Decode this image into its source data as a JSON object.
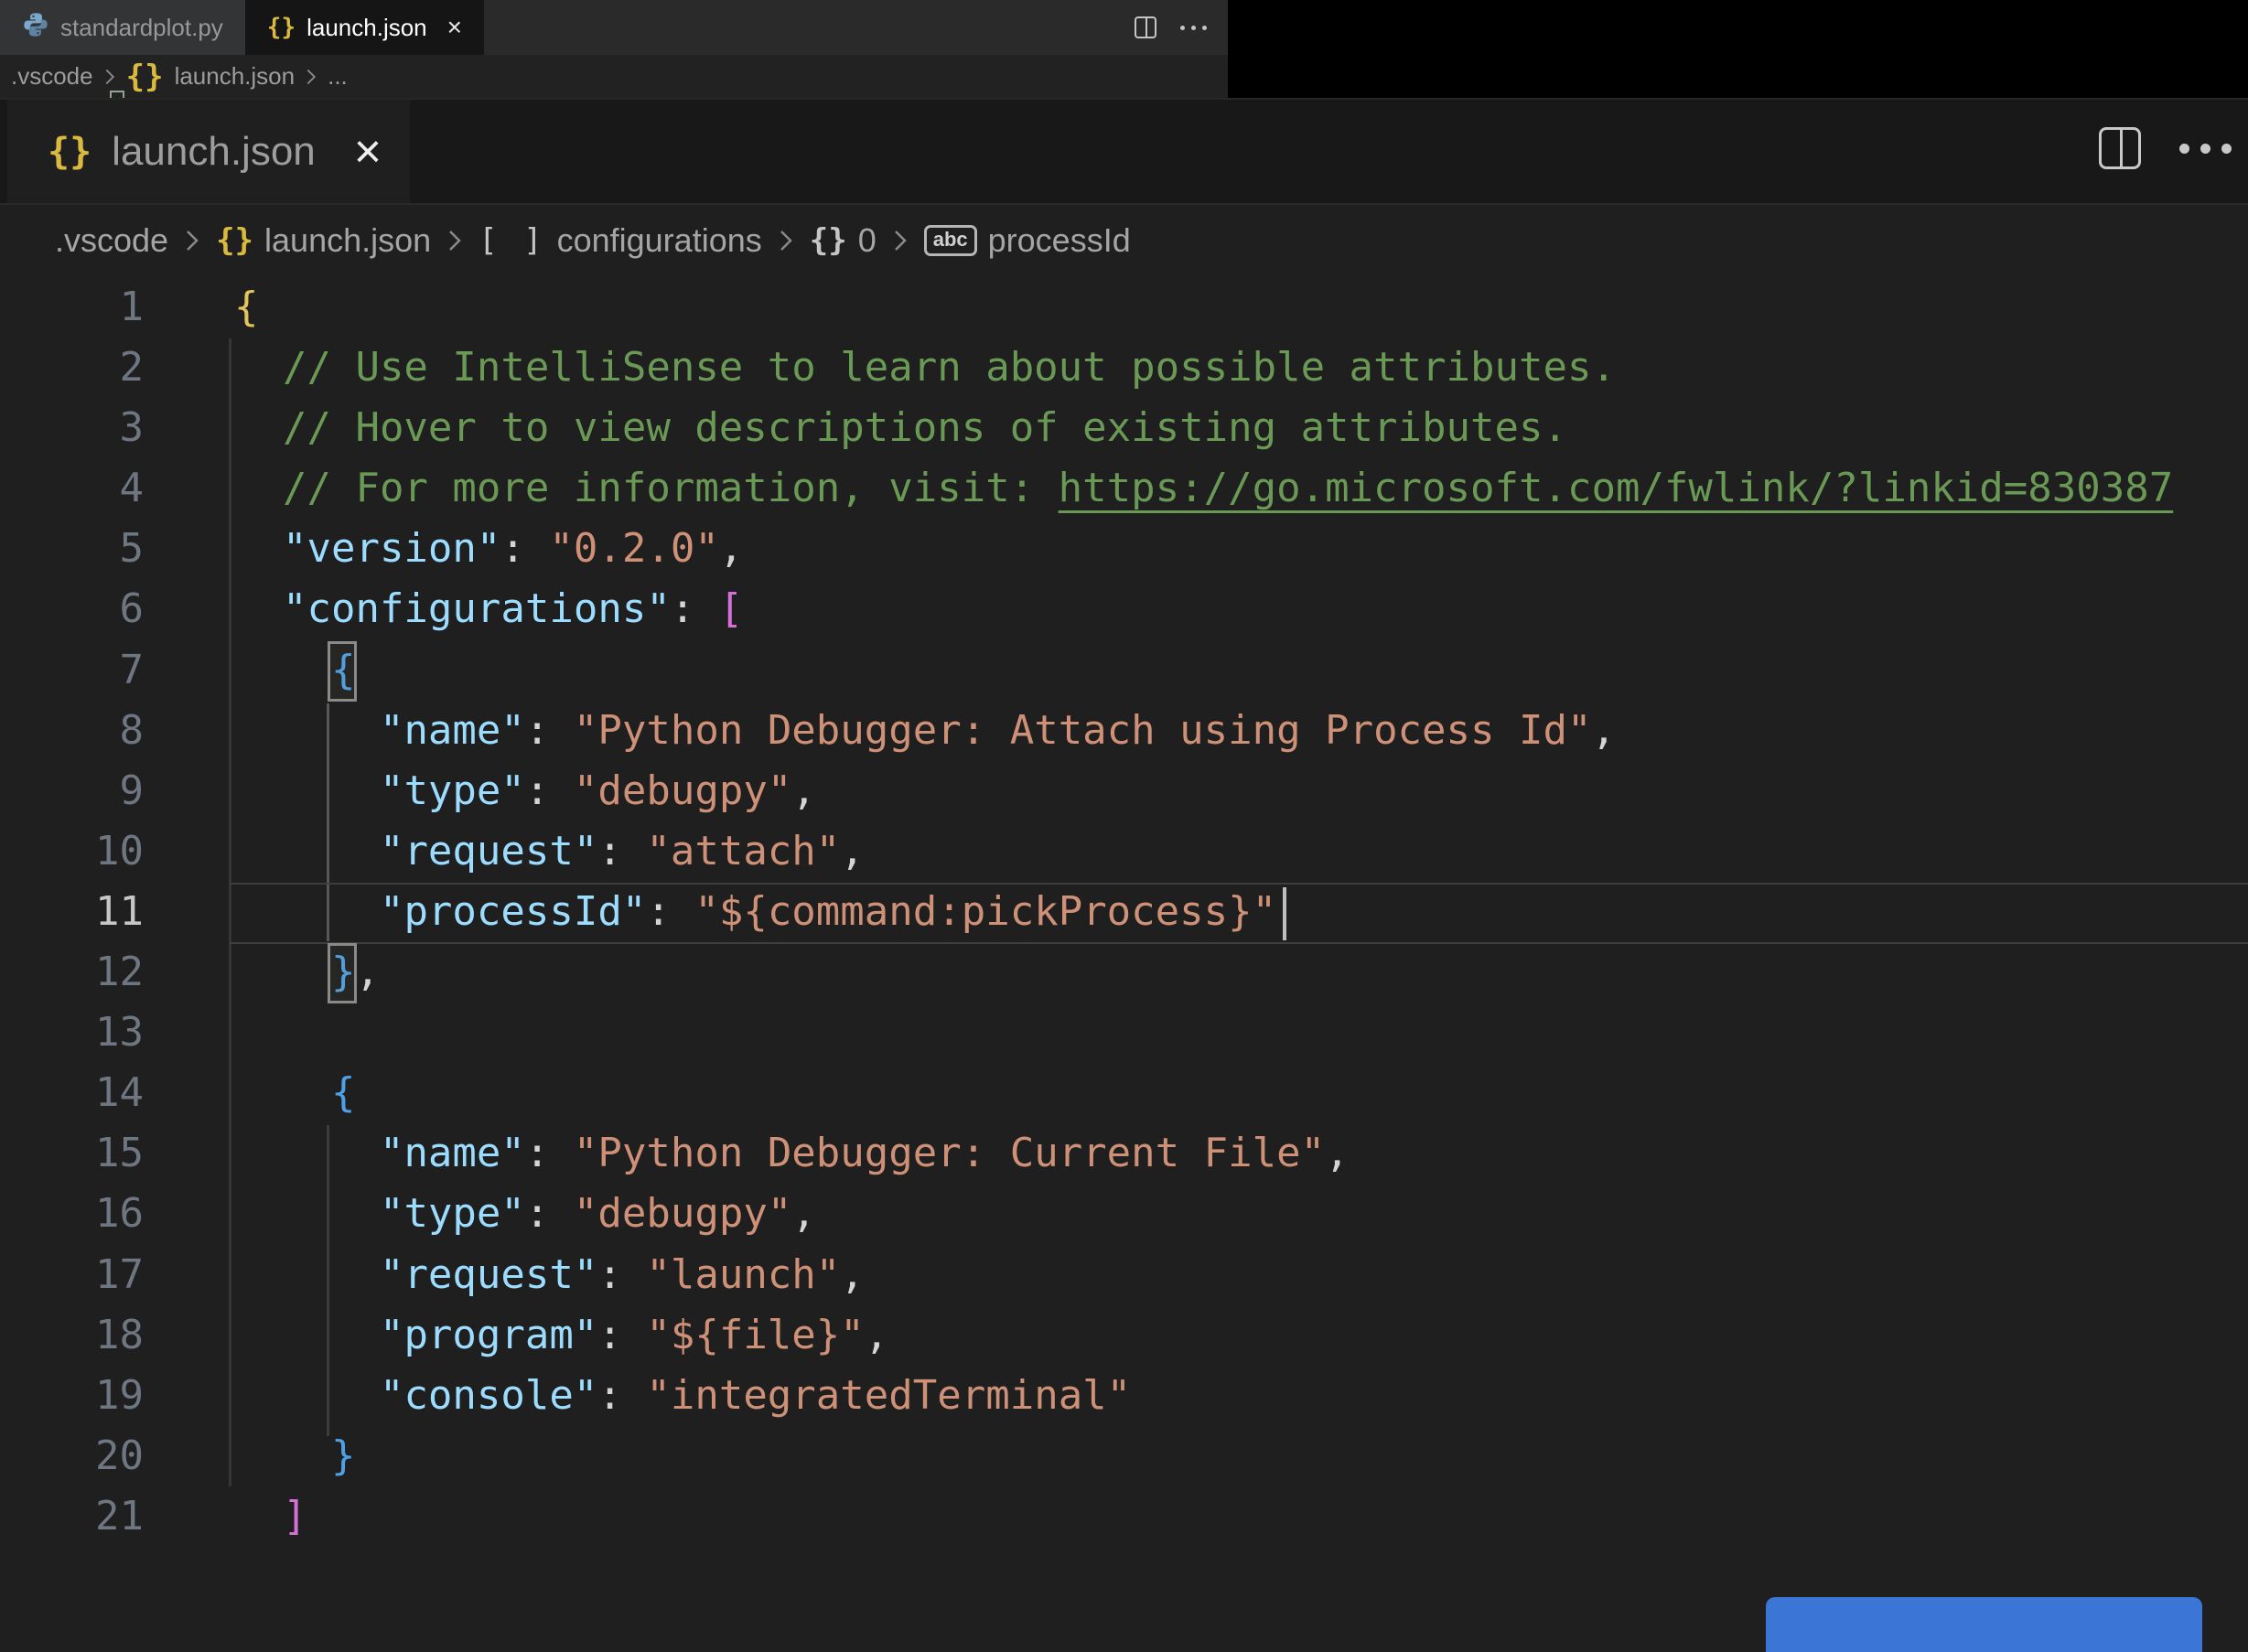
{
  "colors": {
    "editor_bg": "#1f1f1f",
    "tabstrip_bg": "#181818",
    "key": "#9cdcfe",
    "string": "#ce9178",
    "comment": "#6a9955",
    "bracket_level1": "#e3c35c",
    "bracket_level2": "#d670d6",
    "bracket_level3": "#4fa0e6",
    "accent_button": "#3b76d6",
    "braces_icon_gold": "#d9ba3f"
  },
  "top_bar": {
    "tabs": [
      {
        "label": "standardplot.py",
        "icon": "python-icon",
        "active": false,
        "closable": false
      },
      {
        "label": "launch.json",
        "icon": "braces-icon",
        "active": true,
        "closable": true,
        "close_glyph": "×"
      }
    ]
  },
  "top_breadcrumb": {
    "items": [
      {
        "label": ".vscode"
      },
      {
        "label": "launch.json",
        "icon": "braces-gold"
      },
      {
        "label": "..."
      }
    ]
  },
  "zoom_panel": {
    "tab": {
      "label": "launch.json",
      "icon": "braces-gold",
      "close_glyph": "×"
    },
    "breadcrumb": {
      "items": [
        {
          "label": ".vscode"
        },
        {
          "label": "launch.json",
          "icon": "braces-gold"
        },
        {
          "label": "configurations",
          "icon": "brackets"
        },
        {
          "label": "0",
          "icon": "braces"
        },
        {
          "label": "processId",
          "icon": "abc"
        }
      ]
    },
    "editor": {
      "filename": "launch.json",
      "current_line": 11,
      "lines": [
        {
          "n": 1,
          "tokens": [
            [
              "b1",
              "{"
            ]
          ]
        },
        {
          "n": 2,
          "tokens": [
            [
              "c",
              "  // Use IntelliSense to learn about possible attributes."
            ]
          ]
        },
        {
          "n": 3,
          "tokens": [
            [
              "c",
              "  // Hover to view descriptions of existing attributes."
            ]
          ]
        },
        {
          "n": 4,
          "tokens": [
            [
              "c",
              "  // For more information, visit: "
            ],
            [
              "l",
              "https://go.microsoft.com/fwlink/?linkid=830387"
            ]
          ]
        },
        {
          "n": 5,
          "tokens": [
            [
              "p",
              "  "
            ],
            [
              "k",
              "\"version\""
            ],
            [
              "p",
              ": "
            ],
            [
              "s",
              "\"0.2.0\""
            ],
            [
              "p",
              ","
            ]
          ]
        },
        {
          "n": 6,
          "tokens": [
            [
              "p",
              "  "
            ],
            [
              "k",
              "\"configurations\""
            ],
            [
              "p",
              ": "
            ],
            [
              "b2",
              "["
            ]
          ]
        },
        {
          "n": 7,
          "tokens": [
            [
              "p",
              "    "
            ],
            [
              "b3x",
              "{"
            ]
          ]
        },
        {
          "n": 8,
          "tokens": [
            [
              "p",
              "      "
            ],
            [
              "k",
              "\"name\""
            ],
            [
              "p",
              ": "
            ],
            [
              "s",
              "\"Python Debugger: Attach using Process Id\""
            ],
            [
              "p",
              ","
            ]
          ]
        },
        {
          "n": 9,
          "tokens": [
            [
              "p",
              "      "
            ],
            [
              "k",
              "\"type\""
            ],
            [
              "p",
              ": "
            ],
            [
              "s",
              "\"debugpy\""
            ],
            [
              "p",
              ","
            ]
          ]
        },
        {
          "n": 10,
          "tokens": [
            [
              "p",
              "      "
            ],
            [
              "k",
              "\"request\""
            ],
            [
              "p",
              ": "
            ],
            [
              "s",
              "\"attach\""
            ],
            [
              "p",
              ","
            ]
          ]
        },
        {
          "n": 11,
          "current": true,
          "cursor": true,
          "tokens": [
            [
              "p",
              "      "
            ],
            [
              "k",
              "\"processId\""
            ],
            [
              "p",
              ": "
            ],
            [
              "s",
              "\"${command:pickProcess}\""
            ]
          ]
        },
        {
          "n": 12,
          "tokens": [
            [
              "p",
              "    "
            ],
            [
              "b3x",
              "}"
            ],
            [
              "p",
              ","
            ]
          ]
        },
        {
          "n": 13,
          "tokens": []
        },
        {
          "n": 14,
          "tokens": [
            [
              "p",
              "    "
            ],
            [
              "b3",
              "{"
            ]
          ]
        },
        {
          "n": 15,
          "tokens": [
            [
              "p",
              "      "
            ],
            [
              "k",
              "\"name\""
            ],
            [
              "p",
              ": "
            ],
            [
              "s",
              "\"Python Debugger: Current File\""
            ],
            [
              "p",
              ","
            ]
          ]
        },
        {
          "n": 16,
          "tokens": [
            [
              "p",
              "      "
            ],
            [
              "k",
              "\"type\""
            ],
            [
              "p",
              ": "
            ],
            [
              "s",
              "\"debugpy\""
            ],
            [
              "p",
              ","
            ]
          ]
        },
        {
          "n": 17,
          "tokens": [
            [
              "p",
              "      "
            ],
            [
              "k",
              "\"request\""
            ],
            [
              "p",
              ": "
            ],
            [
              "s",
              "\"launch\""
            ],
            [
              "p",
              ","
            ]
          ]
        },
        {
          "n": 18,
          "tokens": [
            [
              "p",
              "      "
            ],
            [
              "k",
              "\"program\""
            ],
            [
              "p",
              ": "
            ],
            [
              "s",
              "\"${file}\""
            ],
            [
              "p",
              ","
            ]
          ]
        },
        {
          "n": 19,
          "tokens": [
            [
              "p",
              "      "
            ],
            [
              "k",
              "\"console\""
            ],
            [
              "p",
              ": "
            ],
            [
              "s",
              "\"integratedTerminal\""
            ]
          ]
        },
        {
          "n": 20,
          "tokens": [
            [
              "p",
              "    "
            ],
            [
              "b3",
              "}"
            ]
          ]
        },
        {
          "n": 21,
          "tokens": [
            [
              "p",
              "  "
            ],
            [
              "b2",
              "]"
            ]
          ]
        }
      ]
    }
  }
}
